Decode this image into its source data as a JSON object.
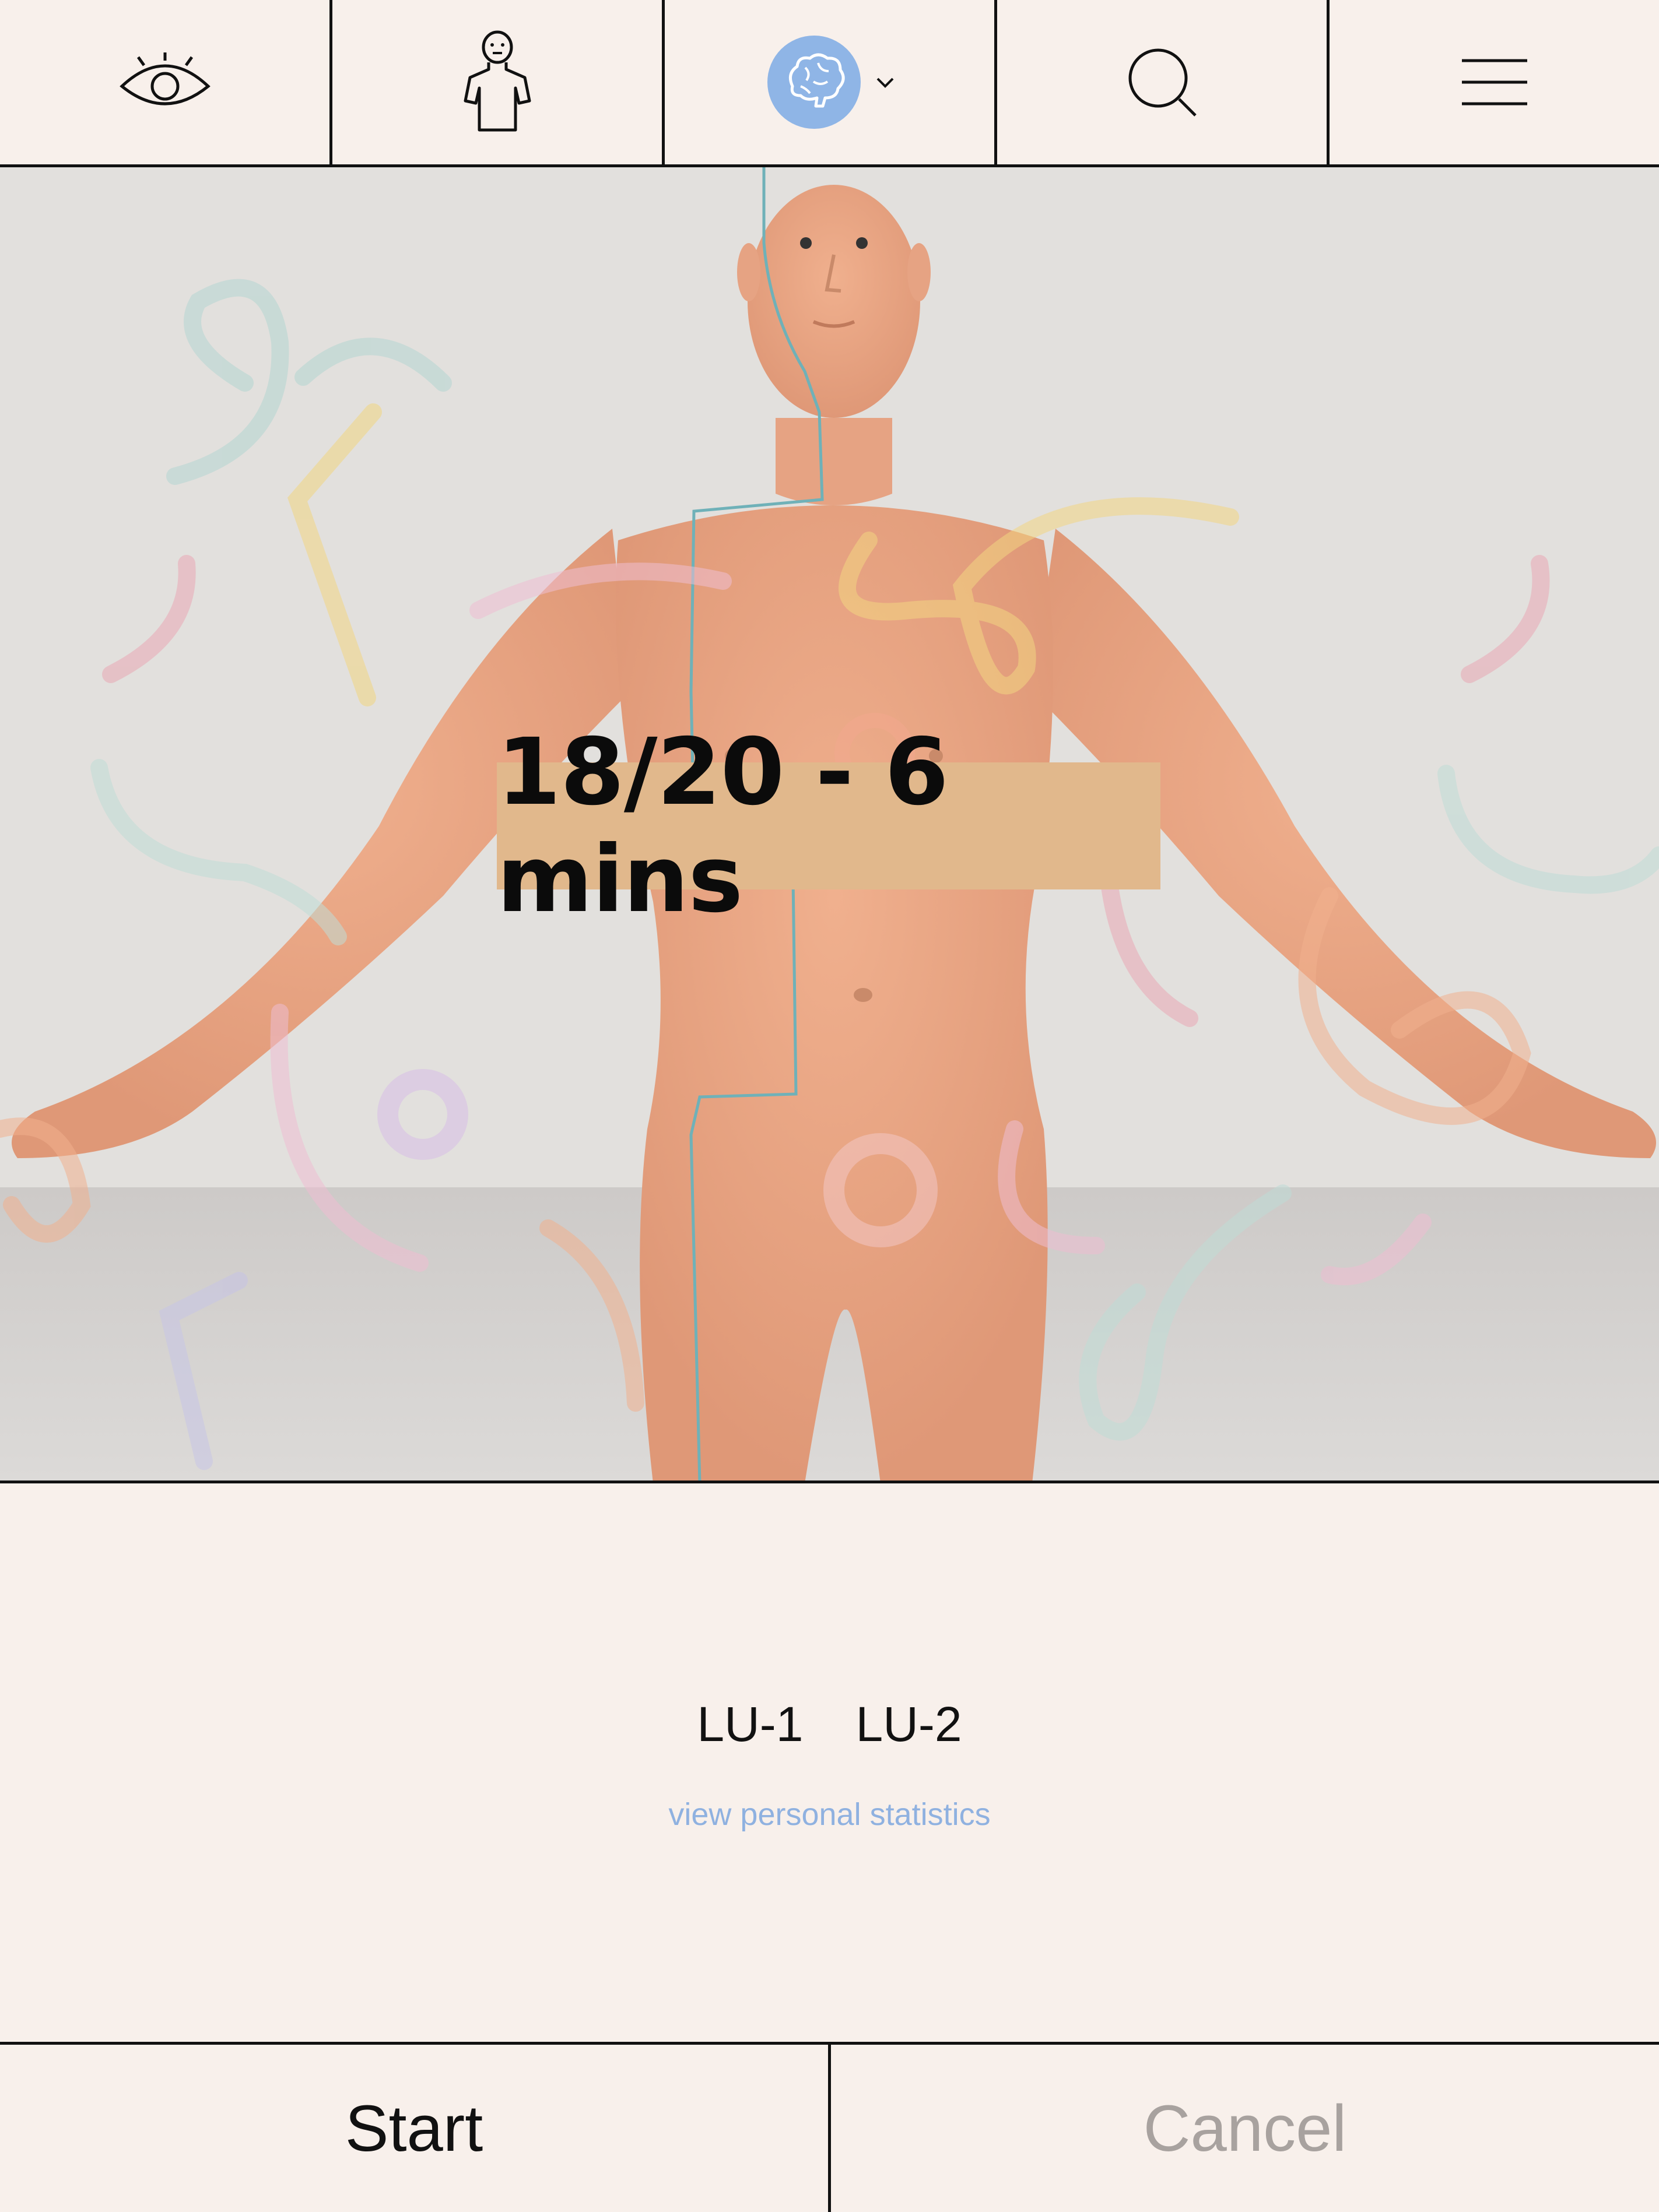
{
  "toolbar": {
    "items": [
      {
        "icon": "eye-icon"
      },
      {
        "icon": "body-figure-icon"
      },
      {
        "icon": "brain-icon",
        "dropdown_indicator": "chevron-down-icon"
      },
      {
        "icon": "search-icon"
      },
      {
        "icon": "hamburger-menu-icon"
      }
    ],
    "accent_color": "#8fb5e6"
  },
  "session": {
    "progress_label": "18/20 - 6 mins"
  },
  "points": {
    "items": [
      "LU-1",
      "LU-2"
    ]
  },
  "stats_link": "view personal statistics",
  "actions": {
    "start_label": "Start",
    "cancel_label": "Cancel"
  },
  "colors": {
    "background": "#f8f0eb",
    "badge": "#e1b88c",
    "link": "#8fb1e0",
    "disabled": "#a8a29f"
  }
}
